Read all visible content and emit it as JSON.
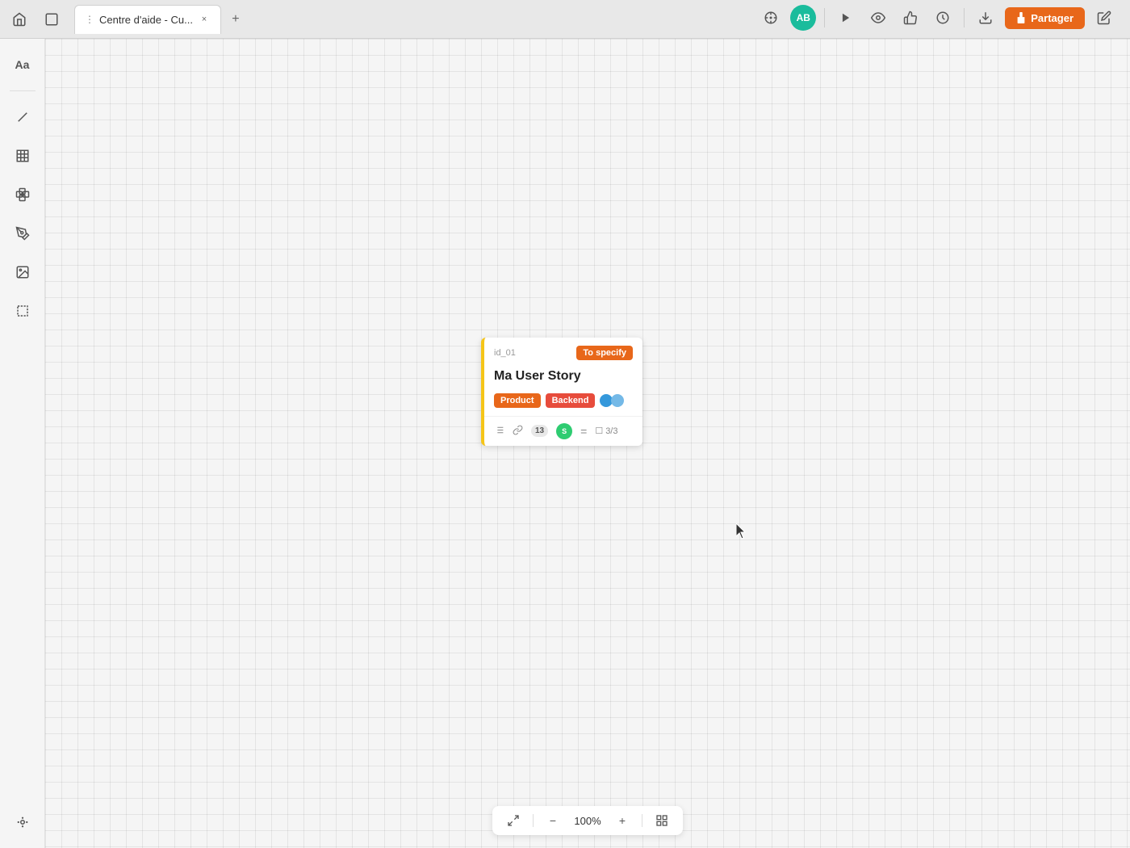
{
  "titleBar": {
    "homeIcon": "⌂",
    "fileIcon": "□",
    "tabMenuIcon": "⋮",
    "tabTitle": "Centre d'aide - Cu...",
    "tabCloseIcon": "×",
    "tabAddIcon": "+"
  },
  "toolbar": {
    "targetIcon": "⊕",
    "avatarLabel": "AB",
    "playIcon": "▶",
    "eyeIcon": "◎",
    "thumbIcon": "👍",
    "clockIcon": "⏱",
    "downloadIcon": "↓",
    "lockIcon": "🔒",
    "shareLabel": "Partager",
    "editIcon": "✎"
  },
  "sidebar": {
    "tools": [
      {
        "name": "text-tool",
        "icon": "Aa"
      },
      {
        "name": "line-tool",
        "icon": "╱"
      },
      {
        "name": "table-tool",
        "icon": "▦"
      },
      {
        "name": "component-tool",
        "icon": "⊞"
      },
      {
        "name": "pen-tool",
        "icon": "✏"
      },
      {
        "name": "image-tool",
        "icon": "🖼"
      },
      {
        "name": "frame-tool",
        "icon": "⬚"
      }
    ]
  },
  "card": {
    "id": "id_01",
    "statusBadge": "To specify",
    "title": "Ma User Story",
    "tags": [
      {
        "label": "Product",
        "color": "#e8671a"
      },
      {
        "label": "Backend",
        "color": "#e74c3c"
      }
    ],
    "toggleLeft": "#3498db",
    "toggleRight": "#74b9e7",
    "footerBadgeCount": "13",
    "avatarLabel": "S",
    "tasksLabel": "3/3"
  },
  "bottomBar": {
    "fitIcon": "↔",
    "zoomOutIcon": "−",
    "zoomLevel": "100%",
    "zoomInIcon": "+",
    "gridIcon": "▦"
  }
}
